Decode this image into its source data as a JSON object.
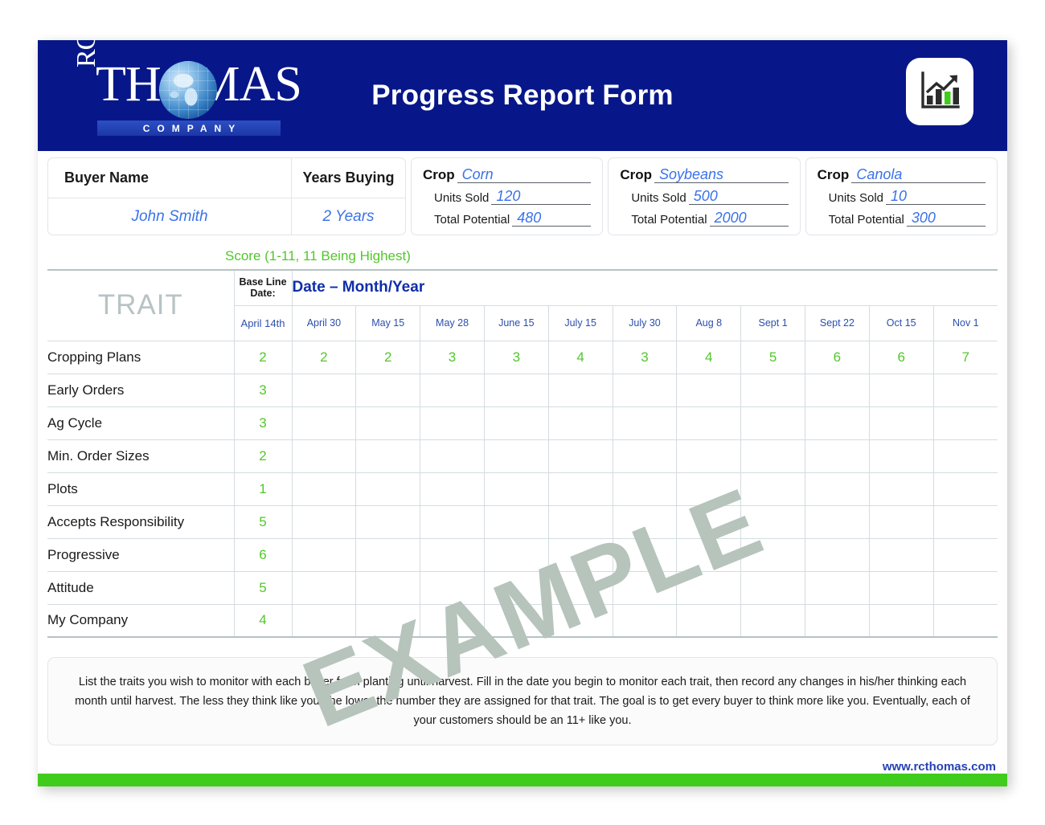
{
  "header": {
    "title": "Progress Report Form",
    "logo": {
      "rc": "RC",
      "wordmark": "THOMAS",
      "subtext": "COMPANY"
    },
    "badge_icon": "bar-chart-growth-icon"
  },
  "info": {
    "buyer_name_label": "Buyer Name",
    "buyer_name_value": "John Smith",
    "years_buying_label": "Years Buying",
    "years_buying_value": "2 Years",
    "crops": [
      {
        "crop_label": "Crop",
        "crop_value": "Corn",
        "units_sold_label": "Units Sold",
        "units_sold_value": "120",
        "total_potential_label": "Total Potential",
        "total_potential_value": "480"
      },
      {
        "crop_label": "Crop",
        "crop_value": "Soybeans",
        "units_sold_label": "Units Sold",
        "units_sold_value": "500",
        "total_potential_label": "Total Potential",
        "total_potential_value": "2000"
      },
      {
        "crop_label": "Crop",
        "crop_value": "Canola",
        "units_sold_label": "Units Sold",
        "units_sold_value": "10",
        "total_potential_label": "Total Potential",
        "total_potential_value": "300"
      }
    ]
  },
  "table": {
    "score_label": "Score (1-11, 11 Being Highest)",
    "trait_header": "TRAIT",
    "baseline_header_line1": "Base Line",
    "baseline_header_line2": "Date:",
    "baseline_date": "April 14th",
    "date_group_header": "Date – Month/Year",
    "date_columns": [
      "April 30",
      "May 15",
      "May 28",
      "June 15",
      "July 15",
      "July 30",
      "Aug 8",
      "Sept 1",
      "Sept 22",
      "Oct 15",
      "Nov 1"
    ],
    "rows": [
      {
        "trait": "Cropping Plans",
        "baseline": "2",
        "scores": [
          "2",
          "2",
          "3",
          "3",
          "4",
          "3",
          "4",
          "5",
          "6",
          "6",
          "7"
        ]
      },
      {
        "trait": "Early Orders",
        "baseline": "3",
        "scores": [
          "",
          "",
          "",
          "",
          "",
          "",
          "",
          "",
          "",
          "",
          ""
        ]
      },
      {
        "trait": "Ag Cycle",
        "baseline": "3",
        "scores": [
          "",
          "",
          "",
          "",
          "",
          "",
          "",
          "",
          "",
          "",
          ""
        ]
      },
      {
        "trait": "Min. Order Sizes",
        "baseline": "2",
        "scores": [
          "",
          "",
          "",
          "",
          "",
          "",
          "",
          "",
          "",
          "",
          ""
        ]
      },
      {
        "trait": "Plots",
        "baseline": "1",
        "scores": [
          "",
          "",
          "",
          "",
          "",
          "",
          "",
          "",
          "",
          "",
          ""
        ]
      },
      {
        "trait": "Accepts Responsibility",
        "baseline": "5",
        "scores": [
          "",
          "",
          "",
          "",
          "",
          "",
          "",
          "",
          "",
          "",
          ""
        ]
      },
      {
        "trait": "Progressive",
        "baseline": "6",
        "scores": [
          "",
          "",
          "",
          "",
          "",
          "",
          "",
          "",
          "",
          "",
          ""
        ]
      },
      {
        "trait": "Attitude",
        "baseline": "5",
        "scores": [
          "",
          "",
          "",
          "",
          "",
          "",
          "",
          "",
          "",
          "",
          ""
        ]
      },
      {
        "trait": "My Company",
        "baseline": "4",
        "scores": [
          "",
          "",
          "",
          "",
          "",
          "",
          "",
          "",
          "",
          "",
          ""
        ]
      }
    ]
  },
  "watermark": "EXAMPLE",
  "note": "List the traits you wish to monitor with each buyer from planting until harvest.  Fill in the date you begin to monitor each trait, then record any changes in his/her thinking each month until harvest.  The less they think like you, the lower the number they are assigned for that trait.  The goal is to get every buyer to think more like you.  Eventually, each of your customers should be an 11+ like you.",
  "website": "www.rcthomas.com",
  "colors": {
    "navy": "#071789",
    "green": "#3fcc1c",
    "score_green": "#52c72b",
    "link_blue": "#2542b5",
    "value_blue": "#3a72e8",
    "watermark_gray": "#b6c4bc"
  }
}
